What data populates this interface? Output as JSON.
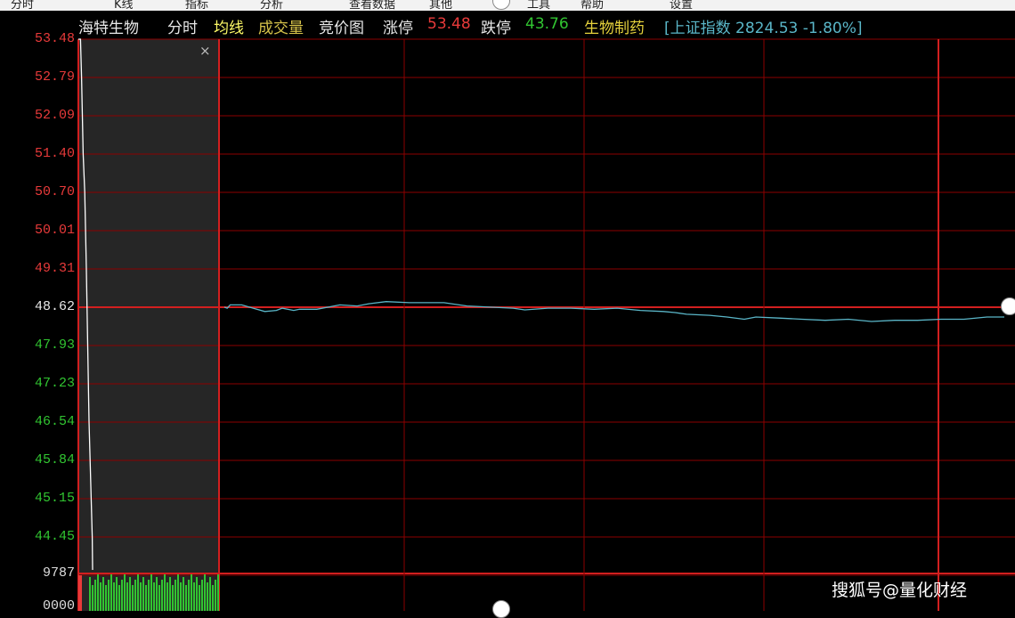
{
  "menu": {
    "items": [
      {
        "label": "分时",
        "left": 0
      },
      {
        "label": "K线",
        "left": 116
      },
      {
        "label": "指标",
        "left": 196
      },
      {
        "label": "分析",
        "left": 280
      },
      {
        "label": "查看数据",
        "left": 380
      },
      {
        "label": "其他",
        "left": 470
      },
      {
        "label": "工具",
        "left": 580
      },
      {
        "label": "帮助",
        "left": 640
      },
      {
        "label": "设置",
        "left": 740
      }
    ]
  },
  "header": {
    "stock_name": "海特生物",
    "tabs": [
      "分时",
      "均线",
      "成交量",
      "竞价图"
    ],
    "limit_up_label": "涨停",
    "limit_up_value": "53.48",
    "limit_down_label": "跌停",
    "limit_down_value": "43.76",
    "sector": "生物制药",
    "index": "[上证指数 2824.53 -1.80%]"
  },
  "colors": {
    "up": "#e83a3a",
    "down": "#31c531",
    "grid": "#8c0000",
    "price_line": "#5ab6c8",
    "auction_bg": "#272727",
    "accent_yellow": "#e6d23c"
  },
  "chart_data": {
    "type": "line",
    "y_ticks": [
      "53.48",
      "52.79",
      "52.09",
      "51.40",
      "50.70",
      "50.01",
      "49.31",
      "48.62",
      "47.93",
      "47.23",
      "46.54",
      "45.84",
      "45.15",
      "44.45"
    ],
    "reference_price": 48.62,
    "ylim": [
      44.45,
      53.48
    ],
    "volume_label": "9787",
    "volume_label_2": "0000",
    "auction_series": [
      [
        0,
        53.48
      ],
      [
        0.04,
        53.48
      ],
      [
        0.06,
        52.79
      ],
      [
        0.09,
        51.4
      ],
      [
        0.12,
        50.7
      ],
      [
        0.15,
        49.31
      ],
      [
        0.2,
        46.54
      ],
      [
        0.26,
        44.45
      ]
    ],
    "price_series": [
      [
        0,
        48.62
      ],
      [
        0.005,
        48.6
      ],
      [
        0.01,
        48.66
      ],
      [
        0.03,
        48.66
      ],
      [
        0.05,
        48.6
      ],
      [
        0.07,
        48.54
      ],
      [
        0.09,
        48.56
      ],
      [
        0.1,
        48.6
      ],
      [
        0.12,
        48.56
      ],
      [
        0.13,
        48.58
      ],
      [
        0.16,
        48.58
      ],
      [
        0.2,
        48.66
      ],
      [
        0.23,
        48.64
      ],
      [
        0.25,
        48.68
      ],
      [
        0.28,
        48.72
      ],
      [
        0.32,
        48.7
      ],
      [
        0.35,
        48.7
      ],
      [
        0.38,
        48.7
      ],
      [
        0.42,
        48.64
      ],
      [
        0.46,
        48.62
      ],
      [
        0.5,
        48.6
      ],
      [
        0.52,
        48.57
      ],
      [
        0.56,
        48.6
      ],
      [
        0.6,
        48.6
      ],
      [
        0.64,
        48.58
      ],
      [
        0.68,
        48.6
      ],
      [
        0.72,
        48.56
      ],
      [
        0.76,
        48.54
      ],
      [
        0.78,
        48.52
      ],
      [
        0.8,
        48.49
      ],
      [
        0.84,
        48.47
      ],
      [
        0.87,
        48.44
      ],
      [
        0.9,
        48.4
      ],
      [
        0.92,
        48.44
      ],
      [
        0.96,
        48.42
      ],
      [
        1.0,
        48.4
      ],
      [
        1.04,
        48.38
      ],
      [
        1.08,
        48.4
      ],
      [
        1.12,
        48.36
      ],
      [
        1.16,
        48.38
      ],
      [
        1.2,
        48.38
      ],
      [
        1.24,
        48.4
      ],
      [
        1.28,
        48.4
      ],
      [
        1.32,
        48.44
      ],
      [
        1.35,
        48.44
      ]
    ]
  },
  "watermark": "搜狐号@量化财经"
}
